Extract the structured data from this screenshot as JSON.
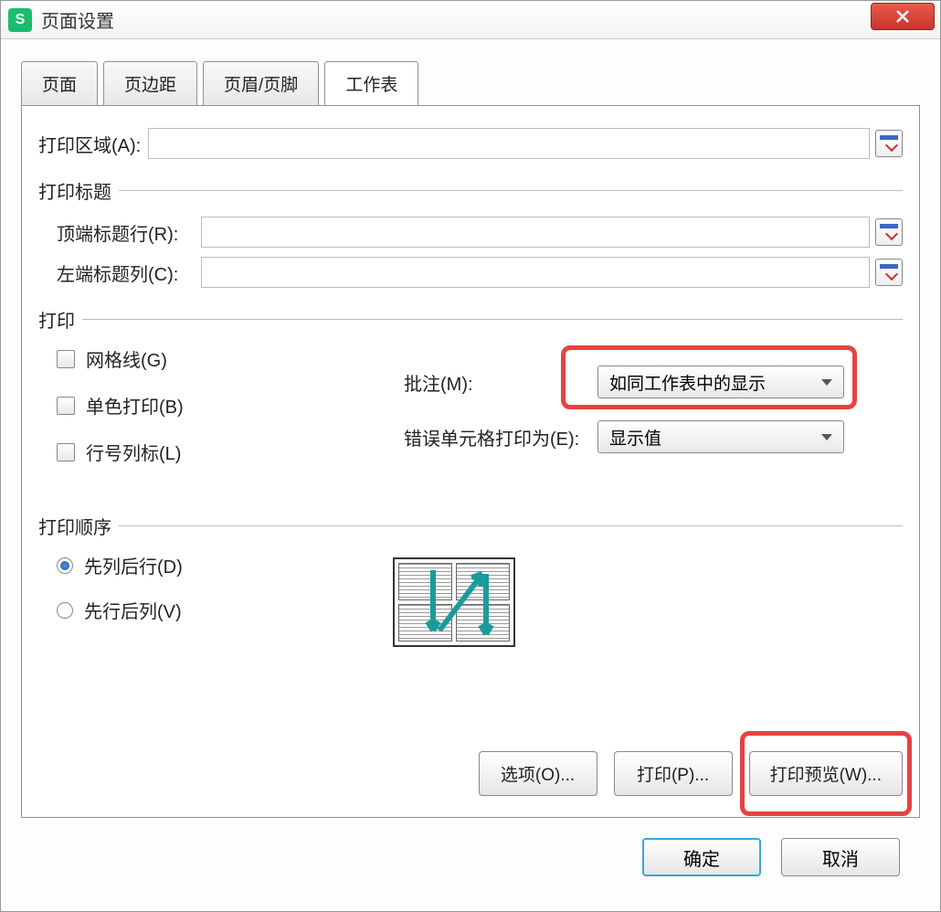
{
  "window": {
    "title": "页面设置",
    "app_icon_letter": "S"
  },
  "tabs": [
    {
      "label": "页面"
    },
    {
      "label": "页边距"
    },
    {
      "label": "页眉/页脚"
    },
    {
      "label": "工作表"
    }
  ],
  "print_area": {
    "label": "打印区域(A):",
    "value": ""
  },
  "print_titles": {
    "legend": "打印标题",
    "top_row": {
      "label": "顶端标题行(R):",
      "value": ""
    },
    "left_col": {
      "label": "左端标题列(C):",
      "value": ""
    }
  },
  "print_section": {
    "legend": "打印",
    "checkboxes": {
      "gridlines": "网格线(G)",
      "monochrome": "单色打印(B)",
      "row_col_headers": "行号列标(L)"
    },
    "comments": {
      "label": "批注(M):",
      "selected": "如同工作表中的显示"
    },
    "errors": {
      "label": "错误单元格打印为(E):",
      "selected": "显示值"
    }
  },
  "page_order": {
    "legend": "打印顺序",
    "down_then_over": "先列后行(D)",
    "over_then_down": "先行后列(V)"
  },
  "buttons": {
    "options": "选项(O)...",
    "print": "打印(P)...",
    "preview": "打印预览(W)..."
  },
  "footer": {
    "ok": "确定",
    "cancel": "取消"
  },
  "colors": {
    "accent_green": "#1abc6e",
    "highlight_red": "#e74242",
    "primary_blue": "#3aa7d4"
  }
}
